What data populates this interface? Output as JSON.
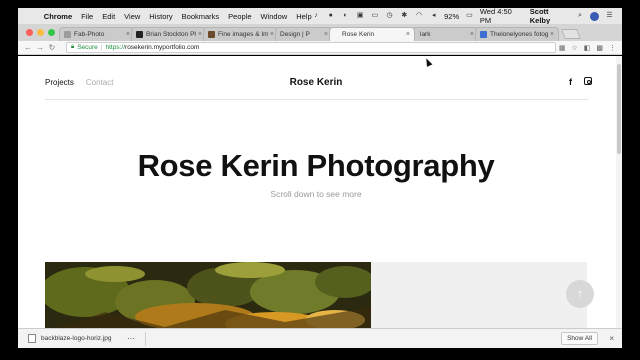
{
  "menubar": {
    "app": "Chrome",
    "items": [
      "File",
      "Edit",
      "View",
      "History",
      "Bookmarks",
      "People",
      "Window",
      "Help"
    ],
    "battery": "92%",
    "clock": "Wed 4:50 PM",
    "user": "Scott Kelby"
  },
  "tabs": [
    {
      "title": "Fab-Photo",
      "color": "#9c9c9c"
    },
    {
      "title": "Brian Stockton Pho",
      "color": "#222222"
    },
    {
      "title": "Fine images & Images in print, m",
      "color": "#6b4a2a"
    },
    {
      "title": "Design | P",
      "color": "#888888"
    },
    {
      "title": "Rose Kerin",
      "color": "#ffffff"
    },
    {
      "title": "lark",
      "color": "#888888"
    },
    {
      "title": "Thelonelyones fotograf",
      "color": "#3b6fd1"
    }
  ],
  "active_tab": 4,
  "address": {
    "secure_label": "Secure",
    "url_proto": "https://",
    "url_rest": "rosekerin.myportfolio.com"
  },
  "site": {
    "nav_projects": "Projects",
    "nav_contact": "Contact",
    "brand": "Rose Kerin",
    "title": "Rose Kerin Photography",
    "subtitle": "Scroll down to see more"
  },
  "download": {
    "filename": "backblaze-logo-horiz.jpg",
    "show_all": "Show All"
  },
  "colors": {
    "close": "#fc605b",
    "minimize": "#fdbc40",
    "zoom": "#34c84a",
    "secure": "#1e8e3e"
  }
}
